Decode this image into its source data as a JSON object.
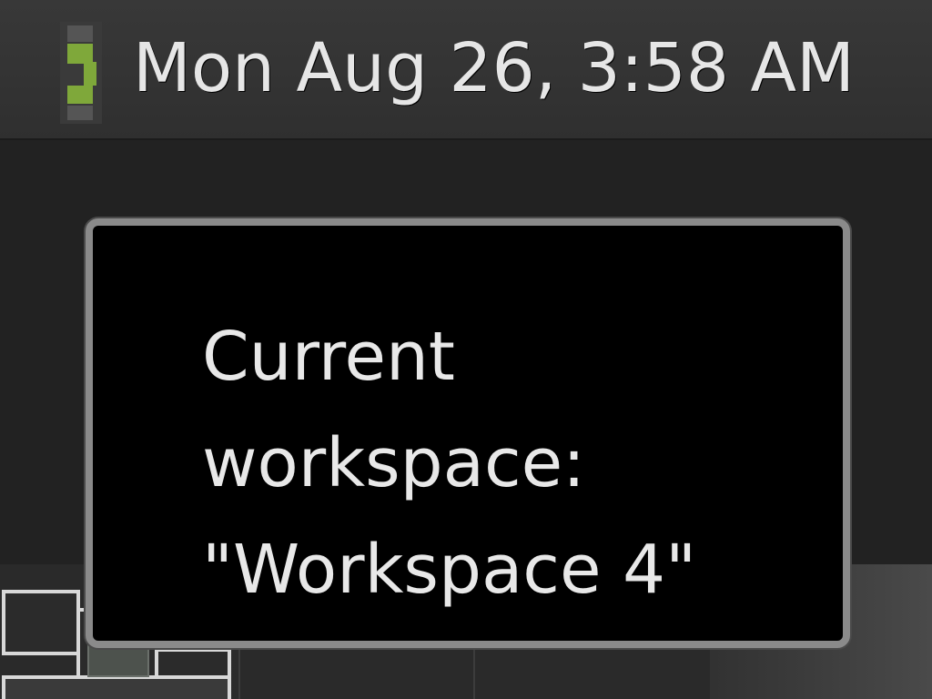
{
  "panel": {
    "clock_text": "Mon Aug 26,  3:58 AM",
    "applet_icon": "workspace-applet-icon",
    "applet_color": "#7fa83a"
  },
  "tooltip": {
    "line1": "Current",
    "line2": "workspace:",
    "line3": "\"Workspace 4\""
  },
  "workspace_switcher": {
    "icon": "workspace-switcher",
    "active_index": 3
  },
  "colors": {
    "panel_bg": "#333333",
    "tooltip_bg": "#000000",
    "tooltip_border": "#8a8a8a",
    "text": "#e8e8e8"
  }
}
